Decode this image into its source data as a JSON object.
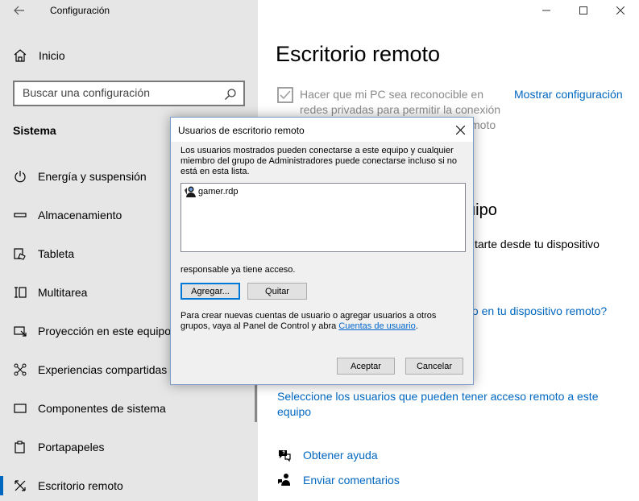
{
  "window": {
    "title": "Configuración",
    "controls": [
      "minimize-icon",
      "maximize-icon",
      "close-icon"
    ]
  },
  "sidebar": {
    "home_label": "Inicio",
    "search": {
      "placeholder": "Buscar una configuración"
    },
    "section_title": "Sistema",
    "items": [
      {
        "label": "Energía y suspensión",
        "icon": "power-icon"
      },
      {
        "label": "Almacenamiento",
        "icon": "storage-icon"
      },
      {
        "label": "Tableta",
        "icon": "tablet-icon"
      },
      {
        "label": "Multitarea",
        "icon": "multitask-icon"
      },
      {
        "label": "Proyección en este equipo",
        "icon": "projection-icon"
      },
      {
        "label": "Experiencias compartidas",
        "icon": "shared-icon"
      },
      {
        "label": "Componentes de sistema",
        "icon": "components-icon"
      },
      {
        "label": "Portapapeles",
        "icon": "clipboard-icon"
      },
      {
        "label": "Escritorio remoto",
        "icon": "remote-desktop-icon",
        "active": true
      }
    ]
  },
  "main": {
    "title": "Escritorio remoto",
    "discoverable_checkbox": {
      "text": "Hacer que mi PC sea reconocible en redes privadas para permitir la conexión",
      "trailing_text": "moto",
      "checked": true
    },
    "show_config_link": "Mostrar configuración",
    "peek_heading_fragment": "uipo",
    "peek_text_1": "tarte desde tu dispositivo",
    "peek_link": "to en tu dispositivo remoto?",
    "users_link": "Seleccione los usuarios que pueden tener acceso remoto a este equipo",
    "help_link": "Obtener ayuda",
    "feedback_link": "Enviar comentarios"
  },
  "dialog": {
    "title": "Usuarios de escritorio remoto",
    "description": "Los usuarios mostrados pueden conectarse a este equipo y cualquier miembro del grupo de Administradores puede conectarse incluso si no está en esta lista.",
    "users": [
      "gamer.rdp"
    ],
    "access_text": "responsable ya tiene acceso.",
    "add_button": "Agregar...",
    "remove_button": "Quitar",
    "info_text": "Para crear nuevas cuentas de usuario o agregar usuarios a otros grupos, vaya al Panel de Control y abra",
    "info_link": "Cuentas de usuario",
    "info_suffix": ".",
    "ok_button": "Aceptar",
    "cancel_button": "Cancelar"
  },
  "colors": {
    "accent": "#0067c0",
    "sidebar_bg": "#e6e6e6",
    "dialog_bg": "#f0f0f0"
  }
}
